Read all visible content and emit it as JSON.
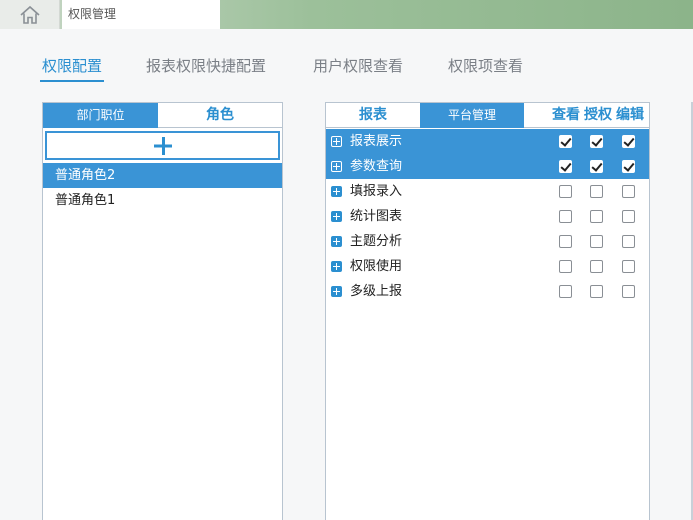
{
  "topbar": {
    "home_icon": "home-icon",
    "active_tab": "权限管理"
  },
  "subtabs": [
    {
      "label": "权限配置",
      "active": true
    },
    {
      "label": "报表权限快捷配置",
      "active": false
    },
    {
      "label": "用户权限查看",
      "active": false
    },
    {
      "label": "权限项查看",
      "active": false
    }
  ],
  "left_panel": {
    "tab_dept": "部门职位",
    "tab_role": "角色",
    "add_icon": "plus-icon",
    "roles": [
      {
        "label": "普通角色2",
        "selected": true
      },
      {
        "label": "普通角色1",
        "selected": false
      }
    ]
  },
  "right_panel": {
    "tab_report": "报表",
    "tab_platform": "平台管理",
    "col_view": "查看",
    "col_grant": "授权",
    "col_edit": "编辑",
    "items": [
      {
        "label": "报表展示",
        "selected": true,
        "view": true,
        "grant": true,
        "edit": true
      },
      {
        "label": "参数查询",
        "selected": true,
        "view": true,
        "grant": true,
        "edit": true
      },
      {
        "label": "填报录入",
        "selected": false,
        "view": false,
        "grant": false,
        "edit": false
      },
      {
        "label": "统计图表",
        "selected": false,
        "view": false,
        "grant": false,
        "edit": false
      },
      {
        "label": "主题分析",
        "selected": false,
        "view": false,
        "grant": false,
        "edit": false
      },
      {
        "label": "权限使用",
        "selected": false,
        "view": false,
        "grant": false,
        "edit": false
      },
      {
        "label": "多级上报",
        "selected": false,
        "view": false,
        "grant": false,
        "edit": false
      }
    ]
  },
  "colors": {
    "accent": "#3a94d6",
    "accent_text": "#2b8fd0"
  }
}
